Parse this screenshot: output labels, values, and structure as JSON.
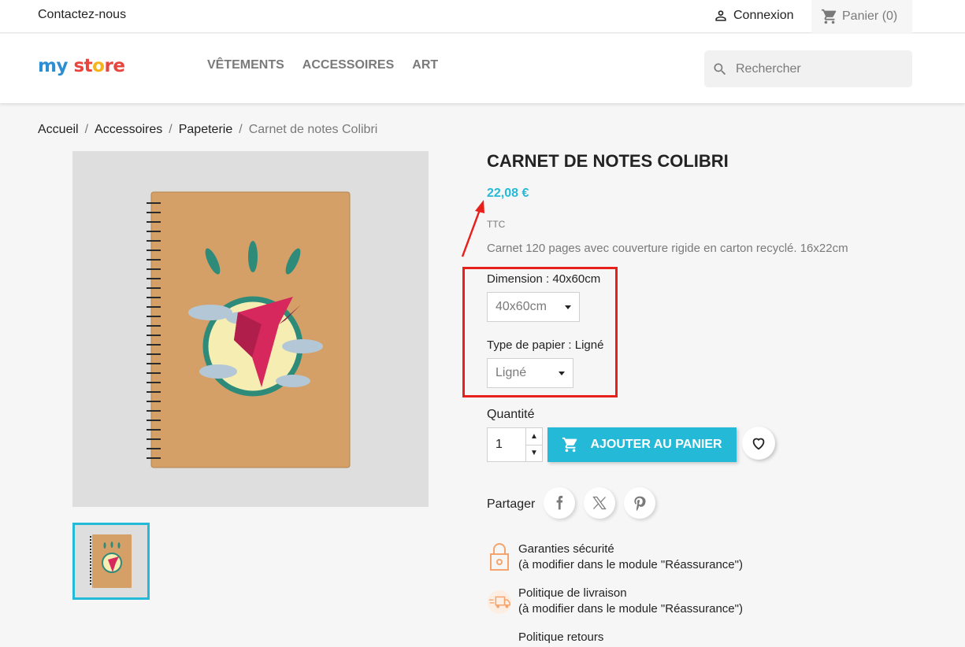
{
  "topbar": {
    "contact": "Contactez-nous",
    "login": "Connexion",
    "cart": "Panier (0)"
  },
  "header": {
    "logo": [
      "my",
      " ",
      "st",
      "o",
      "re"
    ],
    "menu": [
      "VÊTEMENTS",
      "ACCESSOIRES",
      "ART"
    ],
    "search_placeholder": "Rechercher"
  },
  "breadcrumb": [
    "Accueil",
    "Accessoires",
    "Papeterie",
    "Carnet de notes Colibri"
  ],
  "product": {
    "title": "CARNET DE NOTES COLIBRI",
    "price": "22,08 €",
    "tax": "TTC",
    "description": "Carnet 120 pages avec couverture rigide en carton recyclé. 16x22cm",
    "variants": [
      {
        "label": "Dimension : 40x60cm",
        "value": "40x60cm"
      },
      {
        "label": "Type de papier : Ligné",
        "value": "Ligné"
      }
    ],
    "quantity_label": "Quantité",
    "quantity": "1",
    "add_to_cart": "AJOUTER AU PANIER",
    "share_label": "Partager"
  },
  "reassurance": [
    {
      "title": "Garanties sécurité",
      "sub": "(à modifier dans le module \"Réassurance\")",
      "icon": "lock-icon"
    },
    {
      "title": "Politique de livraison",
      "sub": "(à modifier dans le module \"Réassurance\")",
      "icon": "truck-icon"
    },
    {
      "title": "Politique retours",
      "sub": "",
      "icon": "box-icon"
    }
  ],
  "colors": {
    "accent": "#24b9d7",
    "annotation": "#e8201c"
  }
}
